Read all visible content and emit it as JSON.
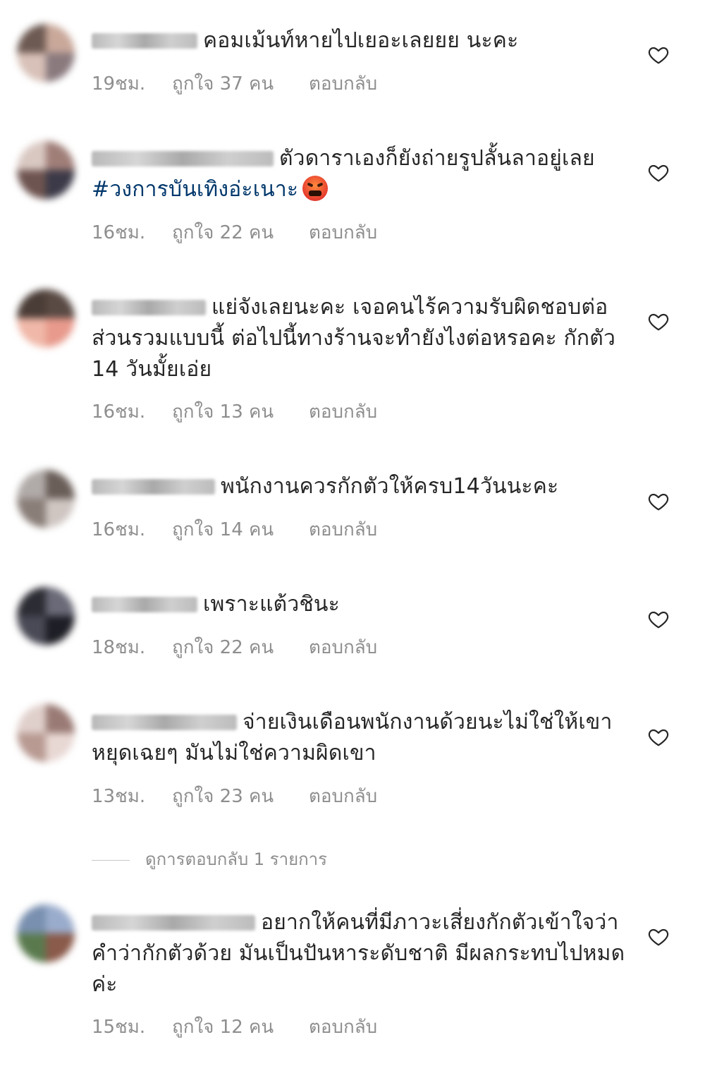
{
  "comments": [
    {
      "text": "คอมเม้นท์หายไปเยอะเลยยย นะคะ",
      "time": "19ชม.",
      "likes": "ถูกใจ 37 คน",
      "reply": "ตอบกลับ"
    },
    {
      "text": "ตัวดาราเองก็ยังถ่ายรูปลั้นลาอยู่เลย ",
      "hashtag": "#วงการบันเทิงอ่ะเนาะ",
      "emoji": "angry-cursing-face-emoji",
      "time": "16ชม.",
      "likes": "ถูกใจ 22 คน",
      "reply": "ตอบกลับ"
    },
    {
      "text": "แย่จังเลยนะคะ เจอคนไร้ความรับผิดชอบต่อส่วนรวมแบบนี้ ต่อไปนี้ทางร้านจะทำยังไงต่อหรอคะ กักตัว 14 วันมั้ยเอ่ย",
      "time": "16ชม.",
      "likes": "ถูกใจ 13 คน",
      "reply": "ตอบกลับ"
    },
    {
      "text": "พนักงานควรกักตัวให้ครบ14วันนะคะ",
      "time": "16ชม.",
      "likes": "ถูกใจ 14 คน",
      "reply": "ตอบกลับ"
    },
    {
      "text": "เพราะแต้วชินะ",
      "time": "18ชม.",
      "likes": "ถูกใจ 22 คน",
      "reply": "ตอบกลับ"
    },
    {
      "text": "จ่ายเงินเดือนพนักงานด้วยนะไม่ใช่ให้เขาหยุดเฉยๆ มันไม่ใช่ความผิดเขา",
      "time": "13ชม.",
      "likes": "ถูกใจ 23 คน",
      "reply": "ตอบกลับ"
    },
    {
      "text": "อยากให้คนที่มีภาวะเสี่ยงกักตัวเข้าใจว่าคำว่ากักตัวด้วย มันเป็นปันหาระดับชาติ มีผลกระทบไปหมดค่ะ",
      "time": "15ชม.",
      "likes": "ถูกใจ 12 คน",
      "reply": "ตอบกลับ"
    }
  ],
  "view_replies": "ดูการตอบกลับ 1 รายการ",
  "colors": {
    "text": "#262626",
    "meta": "#8e8e8e",
    "hashtag": "#00376b",
    "heart_outline": "#262626"
  }
}
